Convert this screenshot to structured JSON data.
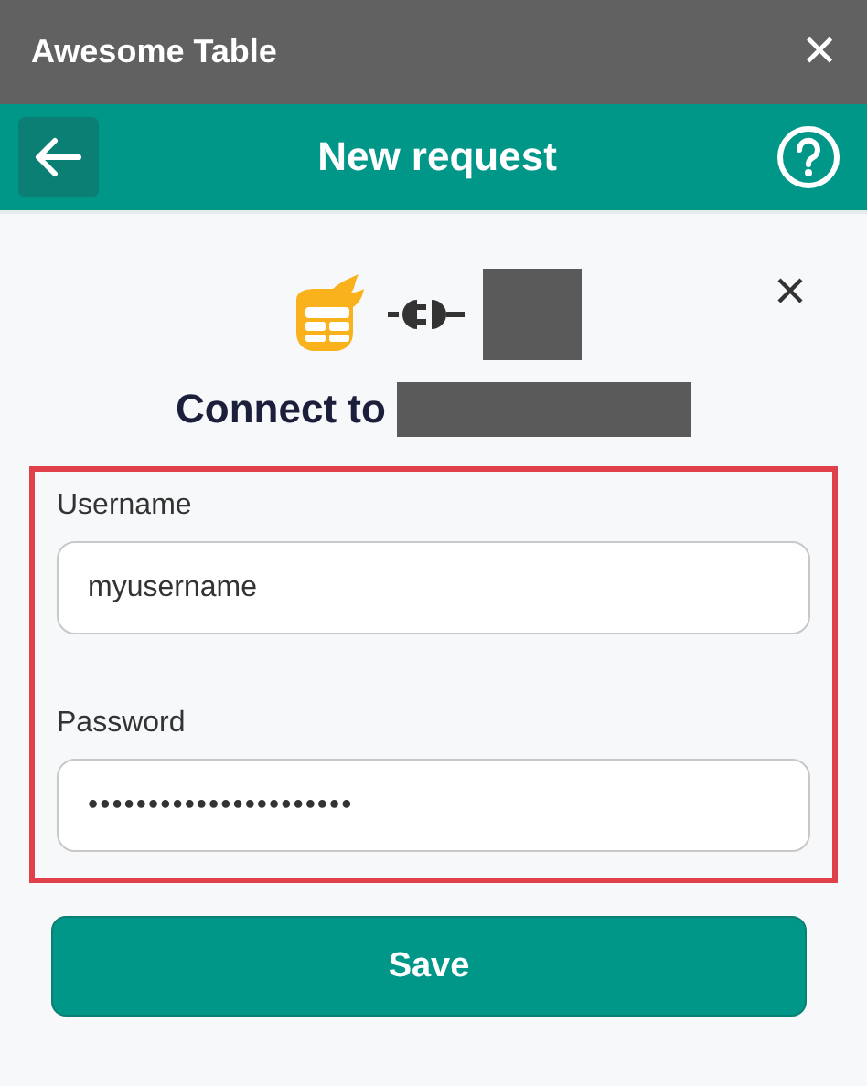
{
  "window": {
    "title": "Awesome Table",
    "close": "✕"
  },
  "header": {
    "title": "New request"
  },
  "connect": {
    "heading": "Connect to",
    "target_redacted": true,
    "service_logo_redacted": true
  },
  "form": {
    "highlighted": true,
    "fields": [
      {
        "label": "Username",
        "value": "myusername",
        "kind": "text"
      },
      {
        "label": "Password",
        "value": "••••••••••••••••••••••",
        "kind": "password"
      }
    ]
  },
  "buttons": [
    "Save"
  ]
}
